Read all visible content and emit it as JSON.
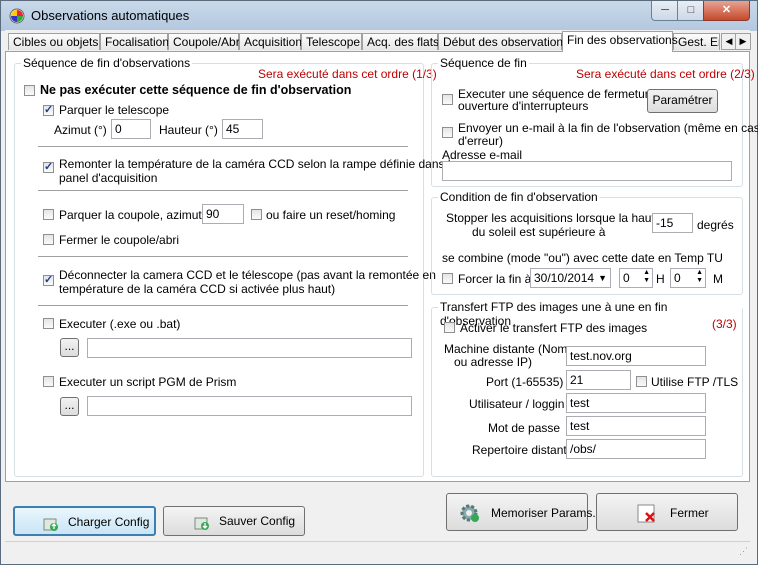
{
  "window": {
    "title": "Observations automatiques",
    "min_label": "─",
    "max_label": "□",
    "close_label": "✕"
  },
  "tabs": [
    {
      "label": "Cibles ou objets"
    },
    {
      "label": "Focalisation"
    },
    {
      "label": "Coupole/Abri"
    },
    {
      "label": "Acquisition"
    },
    {
      "label": "Telescope"
    },
    {
      "label": "Acq. des flats"
    },
    {
      "label": "Début des observations"
    },
    {
      "label": "Fin des observations",
      "active": true
    },
    {
      "label": "Gest. Er"
    }
  ],
  "tab_scroll": {
    "left": "◀",
    "right": "▶"
  },
  "left_group": {
    "title": "Séquence de fin d'observations",
    "order_note": "Sera exécuté dans cet ordre (1/3)",
    "no_execute": {
      "label": "Ne pas exécuter cette séquence de fin d'observation",
      "checked": false
    },
    "park_telescope": {
      "label": "Parquer le telescope",
      "checked": true
    },
    "azimut_label": "Azimut (°) :",
    "azimut_value": "0",
    "hauteur_label": "Hauteur (°) :",
    "hauteur_value": "45",
    "raise_temp": {
      "label_line1": "Remonter la température de la caméra CCD selon la rampe définie dans le",
      "label_line2": "panel d'acquisition",
      "checked": true
    },
    "park_dome": {
      "label": "Parquer la coupole, azimut (°)",
      "checked": false
    },
    "dome_azimut_value": "90",
    "reset_homing": {
      "label": "ou faire un reset/homing",
      "checked": false
    },
    "close_dome": {
      "label": "Fermer le coupole/abri",
      "checked": false
    },
    "disconnect": {
      "label_line1": "Déconnecter la camera CCD et le télescope (pas avant la remontée en",
      "label_line2": "température de la caméra CCD si activée plus haut)",
      "checked": true
    },
    "execute_exe": {
      "label": "Executer (.exe ou .bat)",
      "checked": false
    },
    "browse_label": "...",
    "execute_exe_path": "",
    "execute_pgm": {
      "label": "Executer un script PGM de Prism",
      "checked": false
    },
    "execute_pgm_path": ""
  },
  "right_seq": {
    "title": "Séquence de fin",
    "order_note": "Sera exécuté dans cet ordre (2/3)",
    "close_shutter": {
      "label_line1": "Executer une séquence de fermeture",
      "label_line2": "ouverture d'interrupteurs",
      "checked": false
    },
    "params_button": "Paramétrer",
    "send_email": {
      "label_line1": "Envoyer un e-mail à la fin de l'observation (même en cas",
      "label_line2": "d'erreur)",
      "checked": false
    },
    "email_label": "Adresse e-mail",
    "email_value": ""
  },
  "right_cond": {
    "title": "Condition de fin d'observation",
    "stop_line1": "Stopper les acquisitions lorsque la hauteur",
    "stop_line2": "du soleil est supérieure à",
    "sun_value": "-15",
    "degrees_label": "degrés",
    "combine_label": "se combine (mode \"ou\") avec cette date en Temp TU",
    "force_end": {
      "label": "Forcer la fin à",
      "checked": false
    },
    "date_value": "30/10/2014",
    "hour_value": "0",
    "hour_unit": "H",
    "minute_value": "0",
    "minute_unit": "M"
  },
  "right_ftp": {
    "title": "Transfert FTP des images une à une en fin d'observation",
    "order_note": "(3/3)",
    "activate": {
      "label": "Activer le transfert FTP des images",
      "checked": false
    },
    "host_label_line1": "Machine distante (Nom",
    "host_label_line2": "ou adresse IP)",
    "host_value": "test.nov.org",
    "port_label": "Port (1-65535)",
    "port_value": "21",
    "tls": {
      "label": "Utilise FTP /TLS",
      "checked": false
    },
    "user_label": "Utilisateur / loggin",
    "user_value": "test",
    "password_label": "Mot de passe",
    "password_value": "test",
    "remote_dir_label": "Repertoire distant",
    "remote_dir_value": "/obs/"
  },
  "bottom": {
    "load_config": "Charger Config",
    "save_config": "Sauver Config",
    "memorize_params": "Memoriser Params.",
    "close": "Fermer"
  },
  "colors": {
    "accent_red": "#c00000",
    "titlebar": "#b9cce3"
  }
}
